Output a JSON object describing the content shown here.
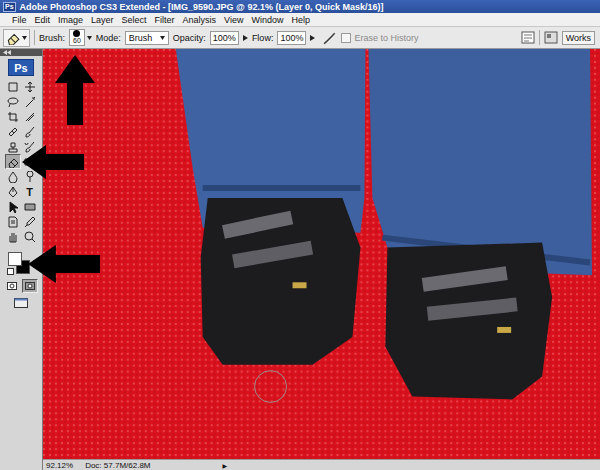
{
  "window": {
    "app_icon": "Ps",
    "title": "Adobe Photoshop CS3 Extended - [IMG_9590.JPG @ 92.1% (Layer 0, Quick Mask/16)]"
  },
  "menu": [
    "File",
    "Edit",
    "Image",
    "Layer",
    "Select",
    "Filter",
    "Analysis",
    "View",
    "Window",
    "Help"
  ],
  "options_bar": {
    "brush_label": "Brush:",
    "brush_size": "60",
    "mode_label": "Mode:",
    "mode": "Brush",
    "opacity_label": "Opacity:",
    "opacity": "100%",
    "flow_label": "Flow:",
    "flow": "100%",
    "erase_to_history": {
      "label": "Erase to History",
      "checked": false,
      "disabled": true
    },
    "workspace": "Works"
  },
  "tools_panel": {
    "logo": "Ps",
    "tools": [
      {
        "kind": "marquee",
        "selected": false
      },
      {
        "kind": "move",
        "selected": false
      },
      {
        "kind": "lasso",
        "selected": false
      },
      {
        "kind": "wand",
        "selected": false
      },
      {
        "kind": "crop",
        "selected": false
      },
      {
        "kind": "slice",
        "selected": false
      },
      {
        "kind": "heal",
        "selected": false
      },
      {
        "kind": "brush",
        "selected": false
      },
      {
        "kind": "stamp",
        "selected": false
      },
      {
        "kind": "history",
        "selected": false
      },
      {
        "kind": "eraser",
        "selected": true
      },
      {
        "kind": "gradient",
        "selected": false
      },
      {
        "kind": "blur",
        "selected": false
      },
      {
        "kind": "dodge",
        "selected": false
      },
      {
        "kind": "pen",
        "selected": false
      },
      {
        "kind": "type",
        "glyph": "T",
        "selected": false
      },
      {
        "kind": "pathselect",
        "selected": false
      },
      {
        "kind": "shape",
        "selected": false
      },
      {
        "kind": "notes",
        "selected": false
      },
      {
        "kind": "eyedropper",
        "selected": false
      },
      {
        "kind": "hand",
        "selected": false
      },
      {
        "kind": "zoom",
        "selected": false
      }
    ],
    "foreground_color": "#ffffff",
    "background_color": "#000000",
    "quick_mask": true
  },
  "annotations": [
    {
      "direction": "up"
    },
    {
      "direction": "left"
    },
    {
      "direction": "left"
    }
  ],
  "status_bar": {
    "zoom": "92.12%",
    "doc": "Doc: 57.7M/62.8M",
    "menu_arrow": "▶"
  }
}
